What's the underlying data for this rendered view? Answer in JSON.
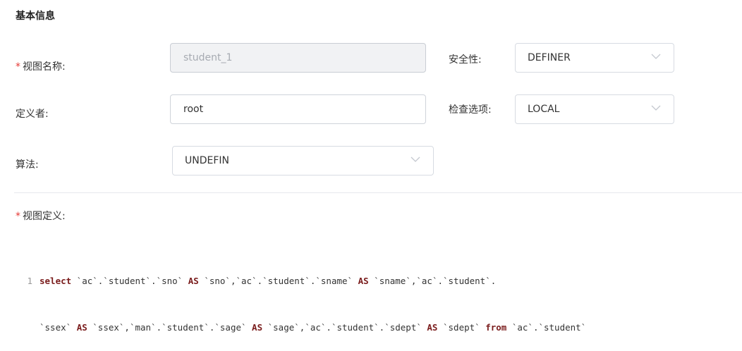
{
  "section": {
    "title": "基本信息"
  },
  "form": {
    "view_name": {
      "label": "视图名称:",
      "required_mark": "*",
      "value": "student_1"
    },
    "security": {
      "label": "安全性:",
      "value": "DEFINER"
    },
    "definer": {
      "label": "定义者:",
      "value": "root"
    },
    "check_option": {
      "label": "检查选项:",
      "value": "LOCAL"
    },
    "algorithm": {
      "label": "算法:",
      "value": "UNDEFIN"
    }
  },
  "definition": {
    "label": "视图定义:",
    "required_mark": "*",
    "lines": [
      {
        "num": "1",
        "kw1": "select",
        "text1": " `ac`.`student`.`sno` ",
        "kw2": "AS",
        "text2": " `sno`,`ac`.`student`.`sname` ",
        "kw3": "AS",
        "text3": " `sname`,`ac`.`student`."
      },
      {
        "num": "",
        "text0": "`ssex` ",
        "kw1": "AS",
        "text1": " `ssex`,`man`.`student`.`sage` ",
        "kw2": "AS",
        "text2": " `sage`,`ac`.`student`.`sdept` ",
        "kw3": "AS",
        "text3": " `sdept` ",
        "kw4": "from",
        "text4": " `ac`.`student`"
      }
    ]
  },
  "icons": {
    "dropdown": "chevron-down-icon"
  }
}
